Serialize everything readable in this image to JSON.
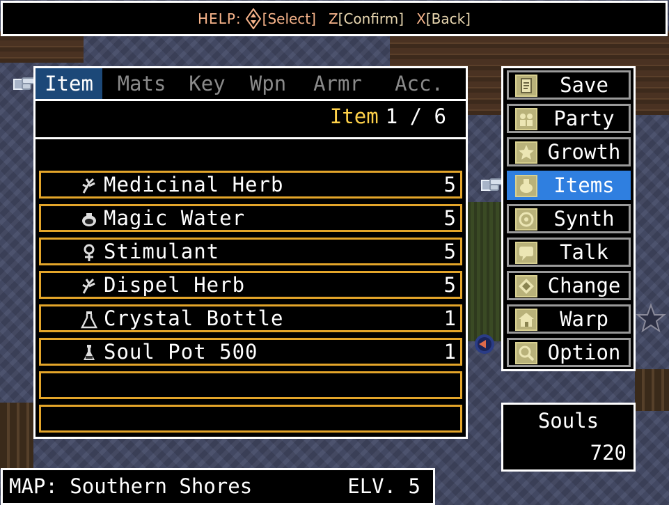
{
  "help": {
    "prefix": "HELP:",
    "select": "[Select]",
    "confirm_key": "Z",
    "confirm": "[Confirm]",
    "back_key": "X",
    "back": "[Back]"
  },
  "tabs": [
    "Item",
    "Mats",
    "Key",
    "Wpn",
    "Armr",
    "Acc."
  ],
  "active_tab": 0,
  "counter": {
    "label": "Item",
    "value": "1 / 6"
  },
  "items": [
    {
      "name": "Medicinal Herb",
      "qty": "5",
      "icon": "herb-icon"
    },
    {
      "name": "Magic Water",
      "qty": "5",
      "icon": "magic-water-icon"
    },
    {
      "name": "Stimulant",
      "qty": "5",
      "icon": "stimulant-icon"
    },
    {
      "name": "Dispel Herb",
      "qty": "5",
      "icon": "herb-icon"
    },
    {
      "name": "Crystal Bottle",
      "qty": "1",
      "icon": "flask-icon"
    },
    {
      "name": "Soul Pot 500",
      "qty": "1",
      "icon": "potion-icon"
    },
    {
      "name": "",
      "qty": "",
      "icon": ""
    },
    {
      "name": "",
      "qty": "",
      "icon": ""
    }
  ],
  "menu": [
    {
      "label": "Save",
      "icon": "save-icon"
    },
    {
      "label": "Party",
      "icon": "party-icon"
    },
    {
      "label": "Growth",
      "icon": "growth-icon"
    },
    {
      "label": "Items",
      "icon": "items-icon"
    },
    {
      "label": "Synth",
      "icon": "synth-icon"
    },
    {
      "label": "Talk",
      "icon": "talk-icon"
    },
    {
      "label": "Change",
      "icon": "change-icon"
    },
    {
      "label": "Warp",
      "icon": "warp-icon"
    },
    {
      "label": "Option",
      "icon": "option-icon"
    }
  ],
  "active_menu": 3,
  "souls": {
    "label": "Souls",
    "value": "720"
  },
  "map": {
    "label": "MAP: Southern Shores",
    "elevation": "ELV. 5"
  },
  "colors": {
    "accent_yellow": "#ffd24a",
    "row_border": "#e3a52a",
    "tab_active": "#1c4878",
    "menu_active": "#2f7fe0"
  }
}
